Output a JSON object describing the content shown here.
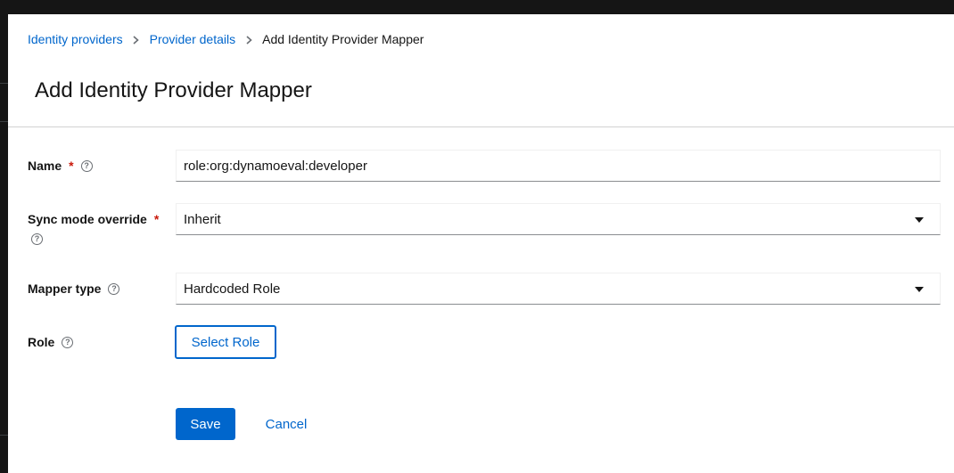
{
  "breadcrumb": {
    "items": [
      {
        "label": "Identity providers"
      },
      {
        "label": "Provider details"
      },
      {
        "label": "Add Identity Provider Mapper"
      }
    ]
  },
  "page": {
    "title": "Add Identity Provider Mapper"
  },
  "form": {
    "name": {
      "label": "Name",
      "required_mark": "*",
      "value": "role:org:dynamoeval:developer"
    },
    "sync_mode": {
      "label": "Sync mode override",
      "required_mark": "*",
      "value": "Inherit"
    },
    "mapper_type": {
      "label": "Mapper type",
      "value": "Hardcoded Role"
    },
    "role": {
      "label": "Role",
      "button_label": "Select Role"
    }
  },
  "actions": {
    "save_label": "Save",
    "cancel_label": "Cancel"
  },
  "icons": {
    "help": "question-circle-icon",
    "separator": "chevron-right-icon",
    "dropdown": "caret-down-icon"
  },
  "colors": {
    "link": "#0066cc",
    "primary": "#0066cc",
    "required": "#c9190b",
    "chrome": "#151515"
  }
}
